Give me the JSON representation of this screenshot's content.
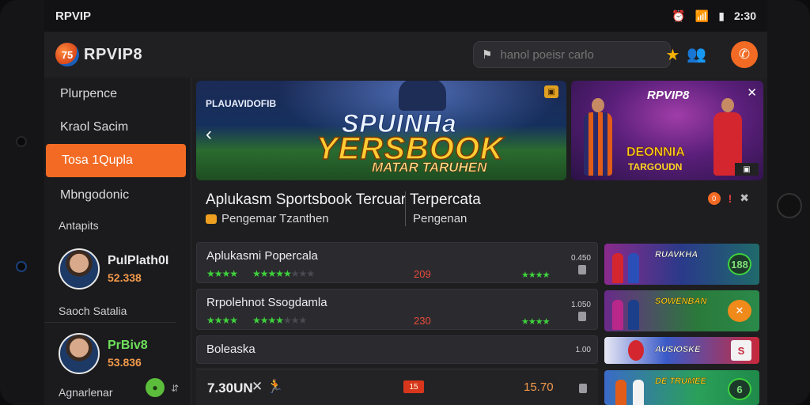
{
  "status": {
    "carrier": "RPVIP",
    "time": "2:30"
  },
  "header": {
    "logo_mark": "75",
    "logo_text": "RPVIP8",
    "search_placeholder": "hanol poeisr carlo"
  },
  "sidebar": {
    "items": [
      "Plurpence",
      "Kraol Sacim",
      "Tosa 1Qupla",
      "Mbngodonic"
    ],
    "section_label": "Antapits",
    "players": [
      {
        "name": "PulPlath0I",
        "score": "52.338"
      },
      {
        "name": "PrBiv8",
        "score": "53.836"
      }
    ],
    "sub_label": "Saoch Satalia",
    "footer": "Agnarlenar"
  },
  "banner_main": {
    "brand": "PLAUAVIDOFIB",
    "line1": "SPUINHa",
    "line2": "YERSBOOK",
    "line3": "MATAR TARUHEN"
  },
  "banner_side": {
    "brand": "RPVIP8",
    "line1": "DEONNIA",
    "line2": "TARGOUDN"
  },
  "info": {
    "headline": "Aplukasm Sportsbook Tercuar Terpercata",
    "sub_left": "Pengemar Tzanthen",
    "sub_right": "Pengenan"
  },
  "rows": [
    {
      "title": "Aplukasmi Popercala",
      "num": "209",
      "small": "0.450"
    },
    {
      "title": "Rrpolehnot Ssogdamla",
      "num": "230",
      "small": "1.050"
    },
    {
      "title": "Boleaska",
      "small": "1.00"
    }
  ],
  "bottom_row": {
    "title": "7.30UN",
    "value": "15.70",
    "tag": "15"
  },
  "promos": [
    {
      "label": "RUAVKHA",
      "badge": "188"
    },
    {
      "label": "SOWENBAN",
      "badge": ""
    },
    {
      "label": "AUSIOSKE",
      "badge": "S"
    },
    {
      "label": "DE TRUMEE",
      "badge": "6"
    }
  ],
  "colors": {
    "accent": "#f26a23",
    "background": "#1e1e21",
    "positive": "#3fd23c",
    "negative": "#ea4a3a"
  }
}
